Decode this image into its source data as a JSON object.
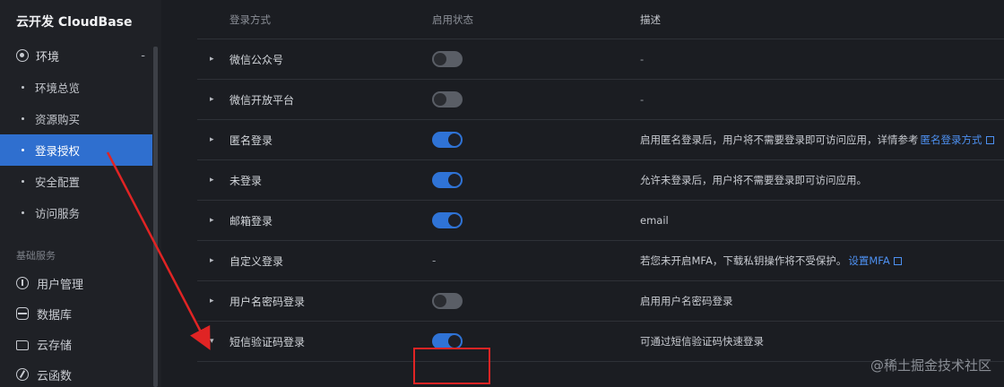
{
  "sidebar": {
    "brand": "云开发 CloudBase",
    "env": {
      "label": "环境",
      "collapse": "-"
    },
    "env_items": [
      {
        "label": "环境总览",
        "active": false
      },
      {
        "label": "资源购买",
        "active": false
      },
      {
        "label": "登录授权",
        "active": true
      },
      {
        "label": "安全配置",
        "active": false
      },
      {
        "label": "访问服务",
        "active": false
      }
    ],
    "section_title": "基础服务",
    "nav_items": [
      {
        "label": "用户管理",
        "icon": "user-icon"
      },
      {
        "label": "数据库",
        "icon": "database-icon"
      },
      {
        "label": "云存储",
        "icon": "folder-icon"
      },
      {
        "label": "云函数",
        "icon": "function-icon"
      }
    ]
  },
  "table": {
    "headers": [
      "登录方式",
      "启用状态",
      "描述"
    ],
    "rows": [
      {
        "name": "微信公众号",
        "enabled": false,
        "desc": "-"
      },
      {
        "name": "微信开放平台",
        "enabled": false,
        "desc": "-"
      },
      {
        "name": "匿名登录",
        "enabled": true,
        "desc": "启用匿名登录后，用户将不需要登录即可访问应用，详情参考",
        "link": "匿名登录方式"
      },
      {
        "name": "未登录",
        "enabled": true,
        "desc": "允许未登录后，用户将不需要登录即可访问应用。"
      },
      {
        "name": "邮箱登录",
        "enabled": true,
        "desc": "email"
      },
      {
        "name": "自定义登录",
        "status_text": "-",
        "desc": "若您未开启MFA，下载私钥操作将不受保护。",
        "link": "设置MFA"
      },
      {
        "name": "用户名密码登录",
        "enabled": false,
        "desc": "启用用户名密码登录"
      },
      {
        "name": "短信验证码登录",
        "enabled": true,
        "expanded": true,
        "desc": "可通过短信验证码快速登录"
      }
    ]
  },
  "watermark": "@稀土掘金技术社区",
  "colors": {
    "accent": "#2f6fcf",
    "highlight": "#e02424",
    "background": "#1b1d22"
  }
}
